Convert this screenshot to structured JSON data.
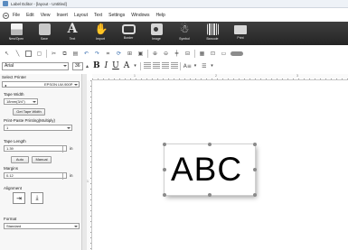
{
  "window": {
    "title": "Label Editor - [layout - Untitled]"
  },
  "menu": {
    "items": [
      "File",
      "Edit",
      "View",
      "Insert",
      "Layout",
      "Text",
      "Settings",
      "Windows",
      "Help"
    ]
  },
  "ribbon": {
    "buttons": [
      {
        "label": "New/Open",
        "icon": "new-document-icon"
      },
      {
        "label": "Save",
        "icon": "save-icon"
      },
      {
        "label": "Text",
        "icon": "text-icon"
      },
      {
        "label": "Import",
        "icon": "import-icon"
      },
      {
        "label": "Border",
        "icon": "border-icon"
      },
      {
        "label": "Image",
        "icon": "image-icon"
      },
      {
        "label": "Symbol",
        "icon": "symbol-icon"
      },
      {
        "label": "Barcode",
        "icon": "barcode-icon"
      },
      {
        "label": "Print",
        "icon": "print-icon"
      }
    ]
  },
  "format_toolbar": {
    "font": "Arial",
    "size": "36",
    "bold": "B",
    "italic": "I",
    "underline": "U",
    "font_color": "A"
  },
  "left_panel": {
    "select_printer_label": "Select Printer",
    "printer_value": "EPSON LW-900P",
    "tape_width_label": "Tape Width",
    "tape_width_value": "18mm(3/4\")",
    "get_tape_width_label": "Get Tape Width",
    "print_paste_label": "Print-Paste Printing(Multiply)",
    "print_paste_value": "1",
    "tape_length_label": "Tape Length",
    "tape_length_value": "1.39",
    "tape_length_unit": "in",
    "auto_label": "Auto",
    "manual_label": "Manual",
    "margins_label": "Margins",
    "margins_value": "0.12",
    "margins_unit": "in",
    "alignment_label": "Alignment",
    "format_label": "Format",
    "format_value": "Standard"
  },
  "ruler": {
    "h_marks": [
      "1",
      "2",
      "3"
    ],
    "v_marks": [
      "1"
    ]
  },
  "canvas": {
    "label_text": "ABC"
  }
}
